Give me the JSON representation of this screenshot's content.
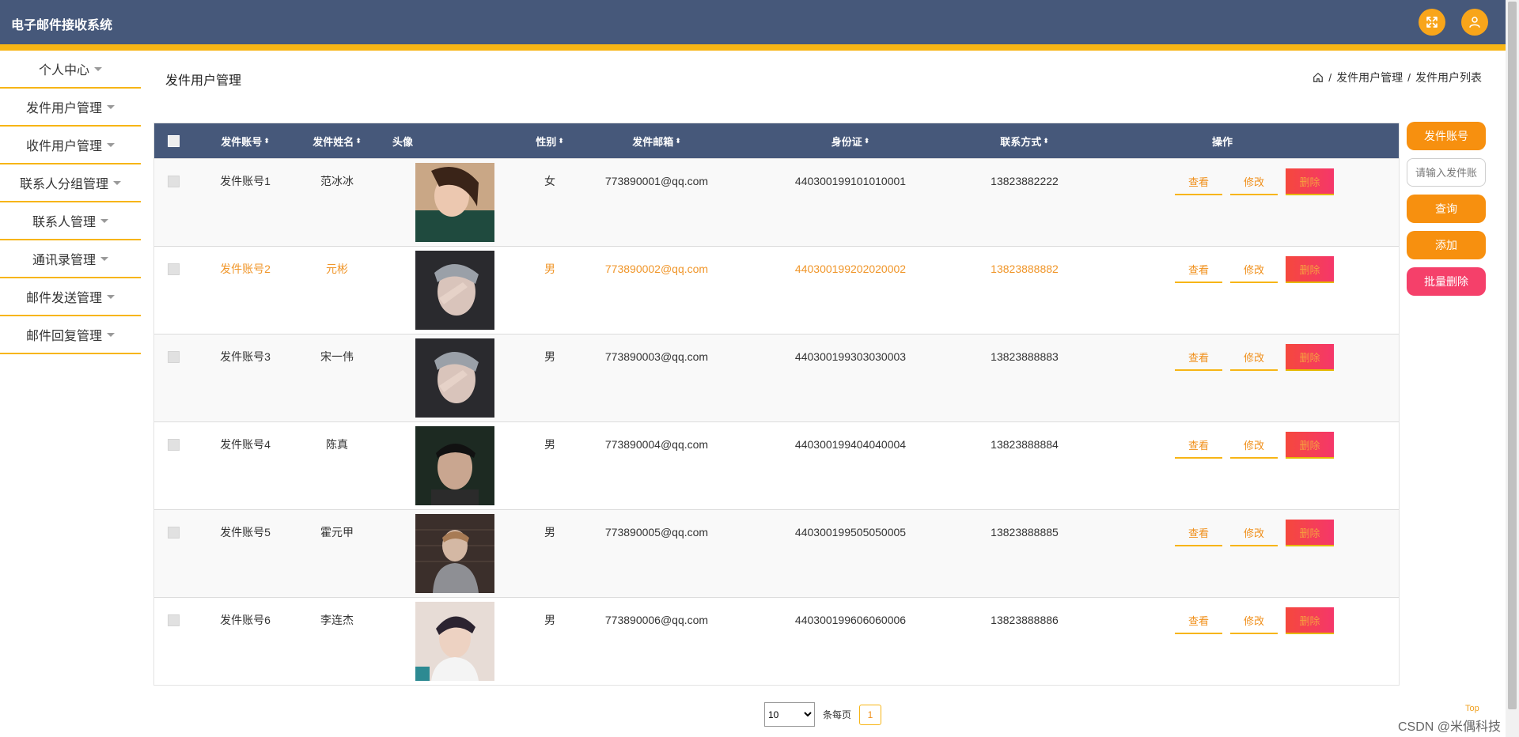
{
  "app": {
    "title": "电子邮件接收系统"
  },
  "header": {
    "fullscreen_icon": "expand-icon",
    "user_icon": "user-icon",
    "accent_color": "#f7b515",
    "bar_color": "#46587a"
  },
  "sidebar": {
    "items": [
      {
        "label": "个人中心"
      },
      {
        "label": "发件用户管理"
      },
      {
        "label": "收件用户管理"
      },
      {
        "label": "联系人分组管理"
      },
      {
        "label": "联系人管理"
      },
      {
        "label": "通讯录管理"
      },
      {
        "label": "邮件发送管理"
      },
      {
        "label": "邮件回复管理"
      }
    ]
  },
  "page": {
    "title": "发件用户管理",
    "breadcrumb": [
      "发件用户管理",
      "发件用户列表"
    ],
    "breadcrumb_sep": "/"
  },
  "table": {
    "columns": {
      "account": "发件账号",
      "name": "发件姓名",
      "avatar": "头像",
      "gender": "性别",
      "email": "发件邮箱",
      "idcard": "身份证",
      "phone": "联系方式",
      "actions": "操作"
    },
    "actions": {
      "view": "查看",
      "edit": "修改",
      "delete": "删除"
    },
    "rows": [
      {
        "account": "发件账号1",
        "name": "范冰冰",
        "gender": "女",
        "email": "773890001@qq.com",
        "idcard": "440300199101010001",
        "phone": "13823882222"
      },
      {
        "account": "发件账号2",
        "name": "元彬",
        "gender": "男",
        "email": "773890002@qq.com",
        "idcard": "440300199202020002",
        "phone": "13823888882"
      },
      {
        "account": "发件账号3",
        "name": "宋一伟",
        "gender": "男",
        "email": "773890003@qq.com",
        "idcard": "440300199303030003",
        "phone": "13823888883"
      },
      {
        "account": "发件账号4",
        "name": "陈真",
        "gender": "男",
        "email": "773890004@qq.com",
        "idcard": "440300199404040004",
        "phone": "13823888884"
      },
      {
        "account": "发件账号5",
        "name": "霍元甲",
        "gender": "男",
        "email": "773890005@qq.com",
        "idcard": "440300199505050005",
        "phone": "13823888885"
      },
      {
        "account": "发件账号6",
        "name": "李连杰",
        "gender": "男",
        "email": "773890006@qq.com",
        "idcard": "440300199606060006",
        "phone": "13823888886"
      }
    ]
  },
  "search": {
    "field_label": "发件账号",
    "placeholder": "请输入发件账号",
    "query_button": "查询",
    "add_button": "添加",
    "batch_delete_button": "批量删除"
  },
  "pagination": {
    "page_size": "10",
    "page_size_options": [
      "10"
    ],
    "per_page_label": "条每页",
    "current_page": "1"
  },
  "footer": {
    "top_link": "Top",
    "watermark": "CSDN @米偶科技"
  }
}
